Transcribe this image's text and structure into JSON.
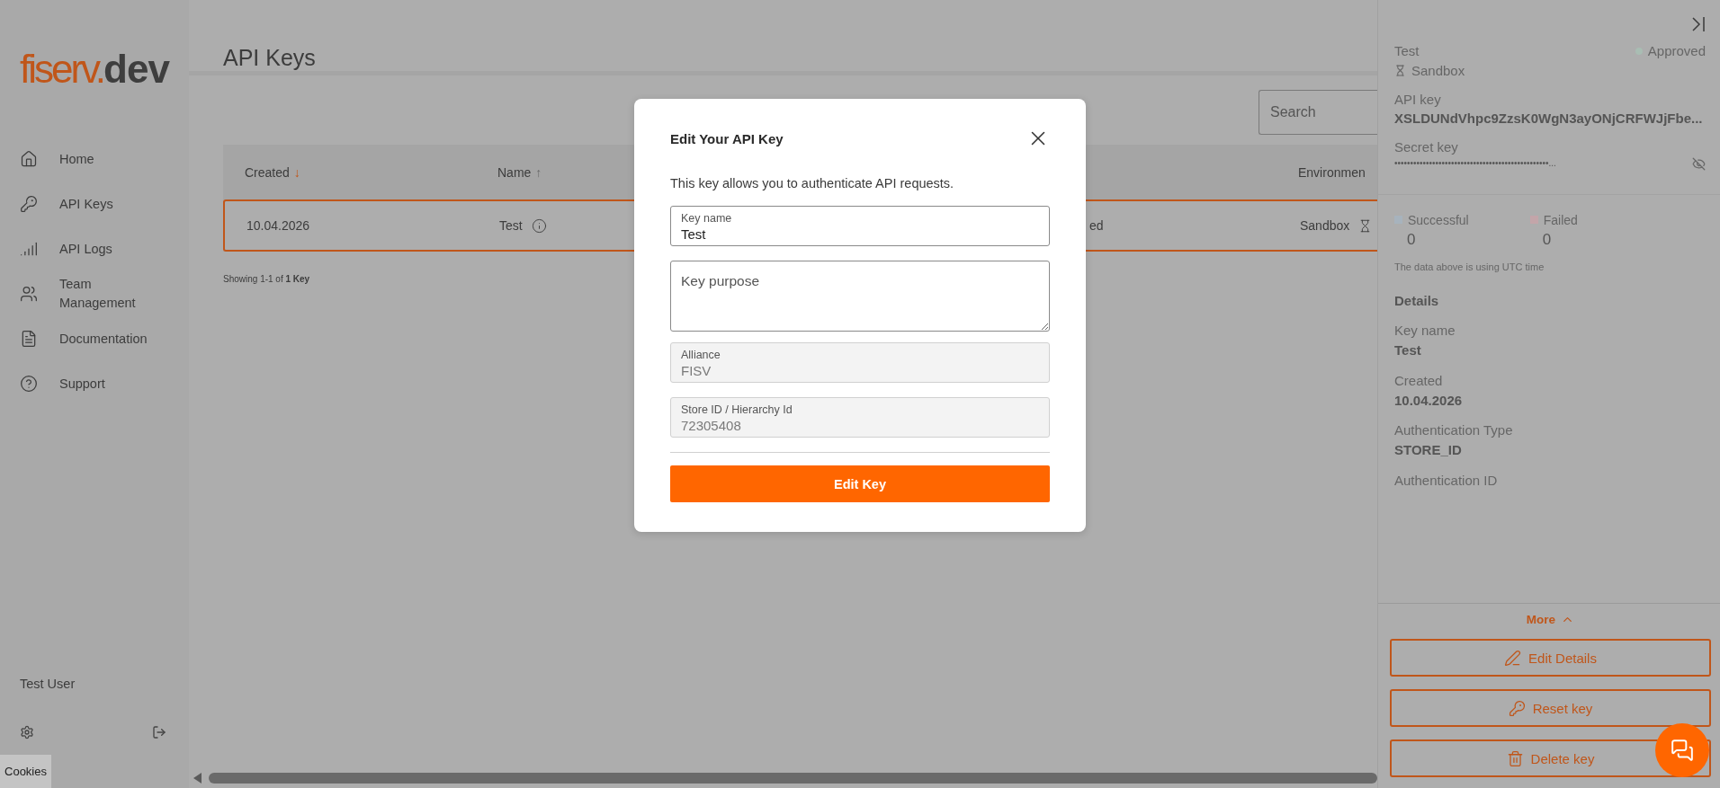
{
  "sidebar": {
    "logo": {
      "brand": "fiserv.",
      "suffix": "dev"
    },
    "items": [
      {
        "label": "Home",
        "selected": false
      },
      {
        "label": "API Keys",
        "selected": false
      },
      {
        "label": "API Logs",
        "selected": false
      },
      {
        "label": "Team Management",
        "selected": false
      },
      {
        "label": "Documentation",
        "selected": false
      },
      {
        "label": "Support",
        "selected": false
      }
    ],
    "user": "Test User",
    "cookies": "Cookies"
  },
  "page": {
    "title": "API Keys",
    "search": {
      "placeholder": "Search"
    },
    "table": {
      "columns": [
        {
          "label": "Created",
          "sort_arrow": "↓",
          "sort_active": true
        },
        {
          "label": "Name",
          "sort_arrow": "↑",
          "sort_active": false
        },
        {
          "label": "Environmen"
        }
      ],
      "rows": [
        {
          "selected": true,
          "created": "10.04.2026",
          "name": "Test",
          "column_3": "ed",
          "environment": "Sandbox"
        }
      ]
    },
    "summary": "Showing 1-1 of **1 Key**"
  },
  "detail_panel": {
    "title": "Test",
    "status": {
      "label": "Approved",
      "color": "#a9bdb3"
    },
    "environment": "Sandbox",
    "api_key": {
      "label": "API key",
      "value": "XSLDUNdVhpc9ZzsK0WgN3ayONjCRFWJjFbe..."
    },
    "secret_key": {
      "label": "Secret key",
      "value": "•••••••••••••••••••••••••••••••••••••••••••••••••..."
    },
    "stats": [
      {
        "label": "Successful",
        "value": "0",
        "color": "#a7b3bd"
      },
      {
        "label": "Failed",
        "value": "0",
        "color": "#c3a5a9"
      }
    ],
    "note": "The data above is using UTC time",
    "details_heading": "Details",
    "details": [
      {
        "label": "Key name",
        "value": "Test"
      },
      {
        "label": "Created",
        "value": "10.04.2026"
      },
      {
        "label": "Authentication Type",
        "value": "STORE_ID"
      },
      {
        "label": "Authentication ID"
      }
    ],
    "more": "More",
    "buttons": [
      "Edit Details",
      "Reset key",
      "Delete key"
    ]
  },
  "modal": {
    "title": "Edit Your API Key",
    "description": "This key allows you to authenticate API requests.",
    "fields": [
      {
        "kind": "input",
        "label": "Key name",
        "value": "Test",
        "disabled": false
      },
      {
        "kind": "textarea",
        "placeholder": "Key purpose"
      },
      {
        "kind": "input",
        "label": "Alliance",
        "value": "FISV",
        "disabled": true
      },
      {
        "kind": "input",
        "label": "Store ID / Hierarchy Id",
        "value": "72305408",
        "disabled": true
      }
    ],
    "submit": "Edit Key"
  }
}
